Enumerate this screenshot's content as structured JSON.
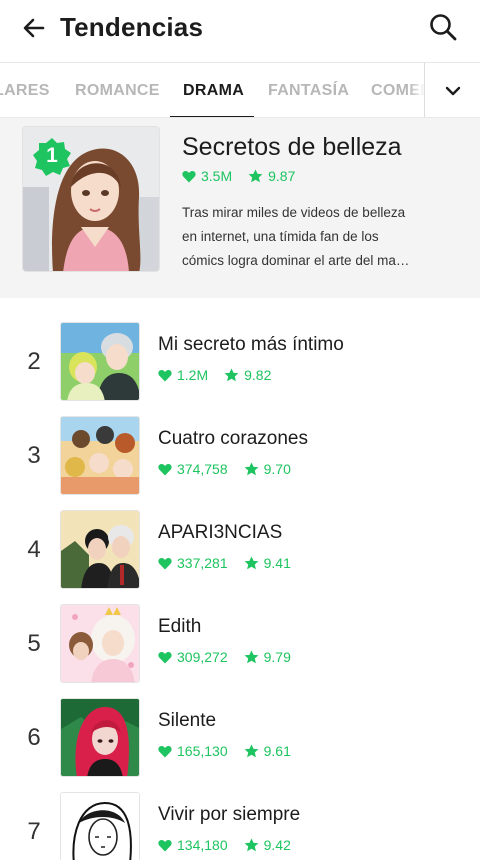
{
  "header": {
    "title": "Tendencias",
    "back_icon": "arrow-left-icon",
    "search_icon": "search-icon"
  },
  "tabs": [
    {
      "label": "LARES",
      "active": false
    },
    {
      "label": "ROMANCE",
      "active": false
    },
    {
      "label": "DRAMA",
      "active": true
    },
    {
      "label": "FANTASÍA",
      "active": false
    },
    {
      "label": "COMEDIA",
      "active": false
    }
  ],
  "tabs_more_icon": "chevron-down-icon",
  "featured": {
    "rank": "1",
    "title": "Secretos de belleza",
    "likes": "3.5M",
    "rating": "9.87",
    "description_lines": [
      "Tras mirar miles de videos de belleza",
      "en internet, una tímida fan de los",
      "cómics logra dominar el arte del ma…"
    ]
  },
  "items": [
    {
      "rank": "2",
      "title": "Mi secreto más íntimo",
      "likes": "1.2M",
      "rating": "9.82"
    },
    {
      "rank": "3",
      "title": "Cuatro corazones",
      "likes": "374,758",
      "rating": "9.70"
    },
    {
      "rank": "4",
      "title": "APARI3NCIAS",
      "likes": "337,281",
      "rating": "9.41"
    },
    {
      "rank": "5",
      "title": "Edith",
      "likes": "309,272",
      "rating": "9.79"
    },
    {
      "rank": "6",
      "title": "Silente",
      "likes": "165,130",
      "rating": "9.61"
    },
    {
      "rank": "7",
      "title": "Vivir por siempre",
      "likes": "134,180",
      "rating": "9.42"
    }
  ],
  "colors": {
    "accent_green": "#1ec460",
    "text_dark": "#1c1c1c",
    "tab_inactive": "#b7b7b7",
    "featured_bg": "#f4f4f4"
  }
}
